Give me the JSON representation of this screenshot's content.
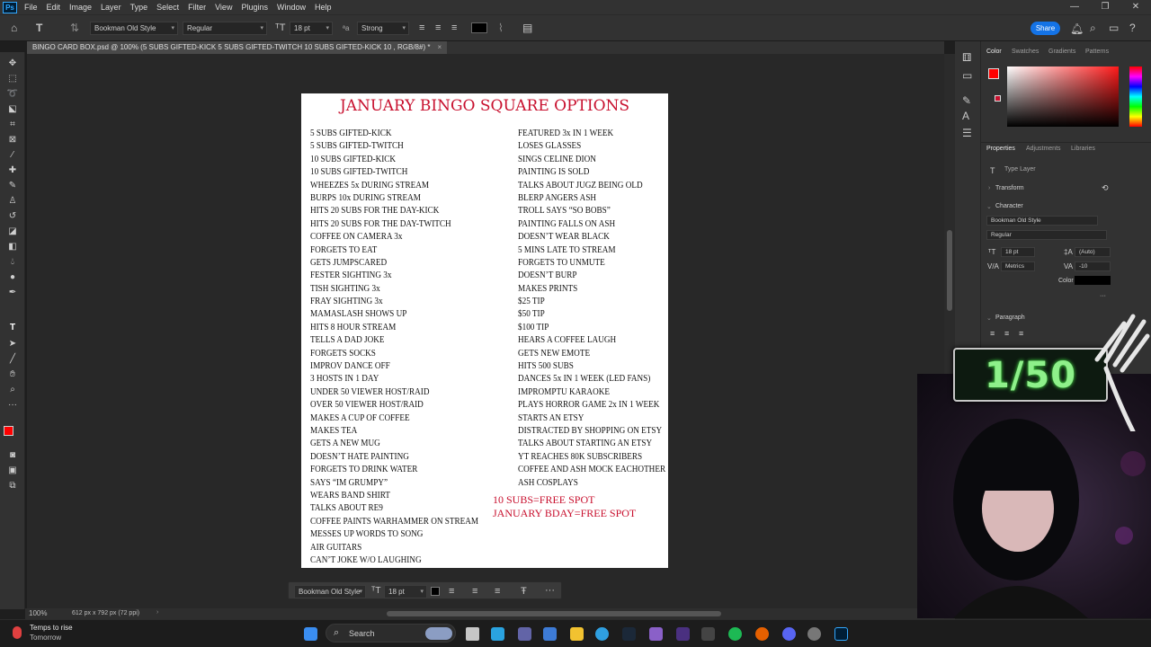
{
  "menubar": {
    "logo": "Ps",
    "items": [
      "File",
      "Edit",
      "Image",
      "Layer",
      "Type",
      "Select",
      "Filter",
      "View",
      "Plugins",
      "Window",
      "Help"
    ]
  },
  "options": {
    "font_family": "Bookman Old Style",
    "font_style": "Regular",
    "font_size": "18 pt",
    "antialias": "Strong",
    "share_label": "Share"
  },
  "document_tab": {
    "title": "BINGO CARD BOX.psd @ 100% (5 SUBS GIFTED-KICK 5 SUBS GIFTED-TWITCH 10 SUBS GIFTED-KICK 10 , RGB/8#) *"
  },
  "document": {
    "title": "JANUARY BINGO SQUARE OPTIONS",
    "column1": [
      "5 SUBS GIFTED-KICK",
      "5 SUBS GIFTED-TWITCH",
      "10 SUBS GIFTED-KICK",
      "10 SUBS GIFTED-TWITCH",
      "WHEEZES 5x DURING STREAM",
      "BURPS 10x DURING STREAM",
      "HITS 20 SUBS FOR THE DAY-KICK",
      "HITS 20 SUBS FOR THE DAY-TWITCH",
      "COFFEE ON CAMERA 3x",
      "FORGETS TO EAT",
      "GETS JUMPSCARED",
      "FESTER SIGHTING 3x",
      "TISH SIGHTING 3x",
      "FRAY SIGHTING 3x",
      "MAMASLASH SHOWS UP",
      "HITS 8 HOUR STREAM",
      "TELLS A DAD JOKE",
      "FORGETS SOCKS",
      "IMPROV DANCE OFF",
      "3 HOSTS IN 1 DAY",
      "UNDER 50 VIEWER HOST/RAID",
      "OVER 50 VIEWER HOST/RAID",
      "MAKES A CUP OF COFFEE",
      "MAKES TEA",
      "GETS A NEW MUG",
      "DOESN’T HATE PAINTING",
      "FORGETS TO DRINK WATER",
      "SAYS “IM GRUMPY”",
      "WEARS BAND SHIRT",
      "TALKS ABOUT RE9",
      "COFFEE PAINTS WARHAMMER ON STREAM",
      "MESSES UP WORDS TO SONG",
      "AIR GUITARS",
      "CAN’T JOKE W/O LAUGHING"
    ],
    "column2": [
      "FEATURED 3x IN 1 WEEK",
      "LOSES GLASSES",
      "SINGS CELINE DION",
      "PAINTING IS SOLD",
      "TALKS ABOUT JUGZ BEING OLD",
      "BLERP ANGERS ASH",
      "TROLL SAYS “SO BOBS”",
      "PAINTING FALLS ON ASH",
      "DOESN’T WEAR BLACK",
      "5 MINS LATE TO STREAM",
      "FORGETS TO UNMUTE",
      "DOESN’T BURP",
      "MAKES PRINTS",
      "$25 TIP",
      "$50 TIP",
      "$100 TIP",
      "HEARS A COFFEE LAUGH",
      "GETS NEW EMOTE",
      "HITS 500 SUBS",
      "DANCES 5x IN 1 WEEK (LED FANS)",
      "IMPROMPTU KARAOKE",
      "PLAYS HORROR GAME 2x IN 1 WEEK",
      "STARTS AN ETSY",
      "DISTRACTED BY SHOPPING ON ETSY",
      "TALKS ABOUT STARTING AN ETSY",
      "YT REACHES 80K SUBSCRIBERS",
      "COFFEE AND ASH MOCK EACHOTHER",
      "ASH COSPLAYS"
    ],
    "free_spot_1": "10 SUBS=FREE SPOT",
    "free_spot_2": "JANUARY BDAY=FREE SPOT"
  },
  "context_bar": {
    "font_family": "Bookman Old Style",
    "font_size": "18 pt",
    "more": "···"
  },
  "statusbar": {
    "zoom": "100%",
    "doc_size": "612 px x 792 px (72 ppi)"
  },
  "panels": {
    "color_tabs": [
      "Color",
      "Swatches",
      "Gradients",
      "Patterns"
    ],
    "properties_tabs": [
      "Properties",
      "Adjustments",
      "Libraries"
    ],
    "layer_type": "Type Layer",
    "transform_label": "Transform",
    "character_label": "Character",
    "char_font": "Bookman Old Style",
    "char_style": "Regular",
    "char_size": "18 pt",
    "char_leading": "(Auto)",
    "char_kerning": "Metrics",
    "char_tracking": "-10",
    "color_label": "Color",
    "paragraph_label": "Paragraph",
    "more": "···"
  },
  "stream_overlay": {
    "counter": "1/50"
  },
  "taskbar": {
    "weather_title": "Temps to rise",
    "weather_sub": "Tomorrow",
    "search_placeholder": "Search"
  },
  "colors": {
    "accent_red": "#c8102e",
    "foreground": "#ff0000",
    "share_blue": "#1473e6"
  }
}
